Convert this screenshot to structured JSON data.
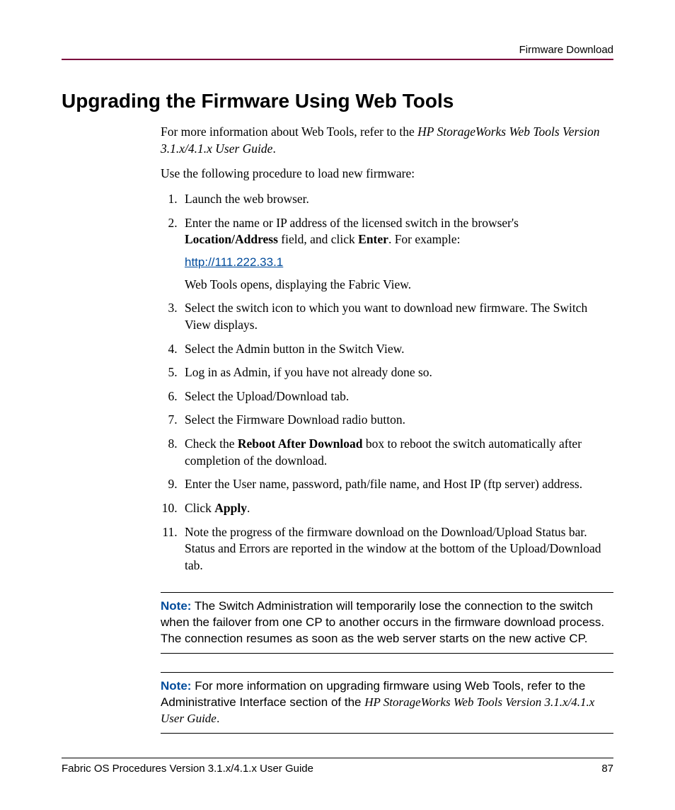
{
  "header": {
    "section": "Firmware Download"
  },
  "title": "Upgrading the Firmware Using Web Tools",
  "intro": {
    "pre": "For more information about Web Tools, refer to the ",
    "ref": "HP StorageWorks Web Tools Version 3.1.x/4.1.x User Guide",
    "post": "."
  },
  "lead": "Use the following procedure to load new firmware:",
  "steps": {
    "s1": "Launch the web browser.",
    "s2": {
      "pre": "Enter the name or IP address of the licensed switch in the browser's ",
      "b1": "Location/Address",
      "mid": " field, and click ",
      "b2": "Enter",
      "post": ". For example:",
      "link": "http://111.222.33.1",
      "after": "Web Tools opens, displaying the Fabric View."
    },
    "s3": "Select the switch icon to which you want to download new firmware. The Switch View displays.",
    "s4": "Select the Admin button in the Switch View.",
    "s5": "Log in as Admin, if you have not already done so.",
    "s6": "Select the Upload/Download tab.",
    "s7": "Select the Firmware Download radio button.",
    "s8": {
      "pre": "Check the ",
      "b1": "Reboot After Download",
      "post": " box to reboot the switch automatically after completion of the download."
    },
    "s9": "Enter the User name, password, path/file name, and Host IP (ftp server) address.",
    "s10": {
      "pre": "Click ",
      "b1": "Apply",
      "post": "."
    },
    "s11": "Note the progress of the firmware download on the Download/Upload Status bar. Status and Errors are reported in the window at the bottom of the Upload/Download tab."
  },
  "note1": {
    "label": "Note:",
    "text": "The Switch Administration will temporarily lose the connection to the switch when the failover from one CP to another occurs in the firmware download process. The connection resumes as soon as the web server starts on the new active CP."
  },
  "note2": {
    "label": "Note:",
    "pre": "For more information on upgrading firmware using Web Tools, refer to the Administrative Interface section of the ",
    "ref": "HP StorageWorks Web Tools Version 3.1.x/4.1.x User Guide",
    "post": "."
  },
  "footer": {
    "doc": "Fabric OS Procedures Version 3.1.x/4.1.x User Guide",
    "page": "87"
  }
}
